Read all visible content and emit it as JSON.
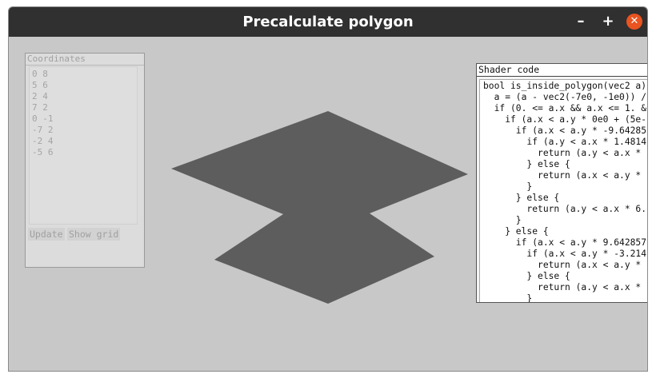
{
  "window": {
    "title": "Precalculate polygon",
    "minimize_label": "–",
    "maximize_label": "+",
    "close_label": "✕"
  },
  "coordinates_panel": {
    "title": "Coordinates",
    "lines": [
      "0 8",
      "5 6",
      "2 4",
      "7 2",
      "0 -1",
      "-7 2",
      "-2 4",
      "-5 6"
    ],
    "update_label": "Update",
    "grid_label": "Show grid"
  },
  "shader_panel": {
    "title": "Shader code",
    "lines": [
      "bool is_inside_polygon(vec2 a) {",
      "  a = (a - vec2(-7e0, -1e0)) /",
      "  if (0. <= a.x && a.x <= 1. &",
      "    if (a.x < a.y * 0e0 + (5e-",
      "      if (a.x < a.y * -9.64285",
      "        if (a.y < a.x * 1.4814",
      "          return (a.y < a.x * ",
      "        } else {",
      "          return (a.x < a.y * ",
      "        }",
      "      } else {",
      "        return (a.y < a.x * 6.",
      "      }",
      "    } else {",
      "      if (a.x < a.y * 9.642857",
      "        if (a.x < a.y * -3.214",
      "          return (a.x < a.y * ",
      "        } else {",
      "          return (a.y < a.x * ",
      "        }"
    ]
  },
  "colors": {
    "titlebar": "#303030",
    "window_background": "#c8c8c8",
    "polygon_fill": "#5d5d5d",
    "close_button": "#e95420"
  }
}
